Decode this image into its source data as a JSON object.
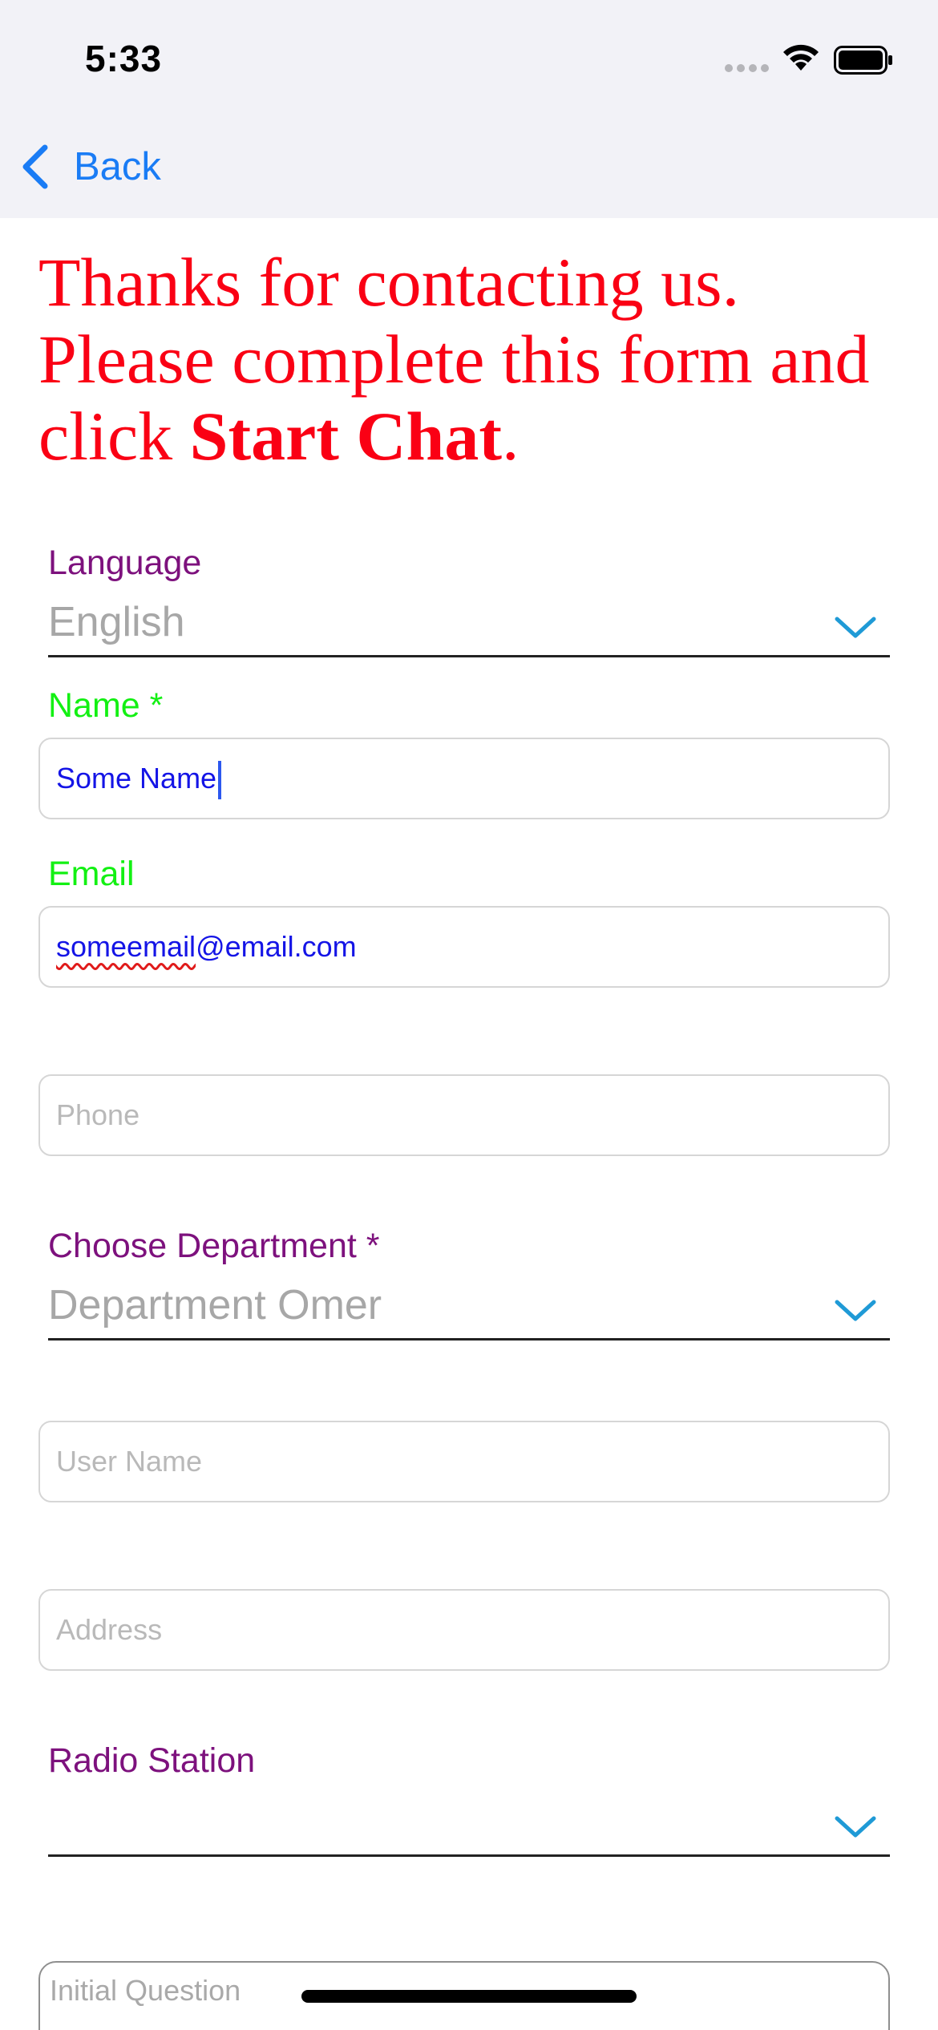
{
  "status_bar": {
    "time": "5:33"
  },
  "nav": {
    "back_label": "Back"
  },
  "intro": {
    "line1": "Thanks for contacting us.",
    "line2": "Please complete this form and",
    "line3_prefix": "click ",
    "line3_bold": "Start Chat",
    "line3_suffix": "."
  },
  "form": {
    "language": {
      "label": "Language",
      "value": "English"
    },
    "name": {
      "label": "Name *",
      "value": "Some Name"
    },
    "email": {
      "label": "Email",
      "value_misspelled": "someemail",
      "value_rest": "@email.com"
    },
    "phone": {
      "placeholder": "Phone"
    },
    "department": {
      "label": "Choose Department *",
      "value": "Department Omer"
    },
    "user_name": {
      "placeholder": "User Name"
    },
    "address": {
      "placeholder": "Address"
    },
    "radio_station": {
      "label": "Radio Station",
      "value": ""
    },
    "initial_question": {
      "placeholder": "Initial Question"
    }
  },
  "colors": {
    "intro_text": "#fa0014",
    "label_purple": "#7d117d",
    "label_green": "#13f013",
    "input_text": "#1414e6",
    "accent_blue": "#1a7cf5",
    "chevron": "#1f9ad6"
  },
  "icons": {
    "back": "chevron-left-icon",
    "dropdown": "chevron-down-icon",
    "wifi": "wifi-icon",
    "battery": "battery-icon",
    "signal": "cellular-signal-icon"
  }
}
